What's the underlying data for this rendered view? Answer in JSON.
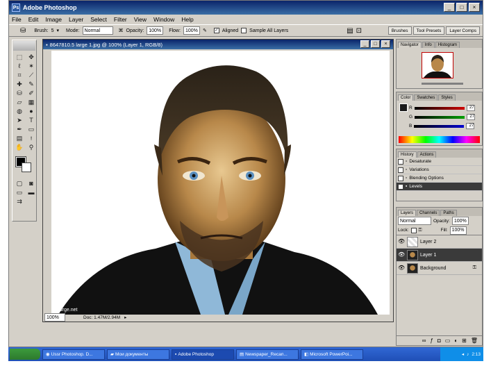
{
  "window": {
    "title": "Adobe Photoshop"
  },
  "menu": [
    "File",
    "Edit",
    "Image",
    "Layer",
    "Select",
    "Filter",
    "View",
    "Window",
    "Help"
  ],
  "options": {
    "brush_label": "Brush:",
    "brush_size": "5",
    "mode_label": "Mode:",
    "mode_value": "Normal",
    "opacity_label": "Opacity:",
    "opacity_value": "100%",
    "flow_label": "Flow:",
    "flow_value": "100%",
    "aligned_label": "Aligned",
    "sample_all_label": "Sample All Layers"
  },
  "palette_well": [
    "Brushes",
    "Tool Presets",
    "Layer Comps"
  ],
  "document": {
    "title": "8647810.5 large 1.jpg @ 100% (Layer 1, RGB/8)",
    "zoom": "100%",
    "doc_info": "Doc: 1.47M/2.94M",
    "watermark": "hourge.net"
  },
  "navigator": {
    "tabs": [
      "Navigator",
      "Info",
      "Histogram"
    ]
  },
  "color": {
    "tabs": [
      "Color",
      "Swatches",
      "Styles"
    ],
    "channels": [
      {
        "label": "R",
        "value": "27",
        "color": "#d00000"
      },
      {
        "label": "G",
        "value": "27",
        "color": "#00a000"
      },
      {
        "label": "B",
        "value": "27",
        "color": "#0000d0"
      }
    ]
  },
  "history": {
    "tabs": [
      "History",
      "Actions"
    ],
    "items": [
      "Desaturate",
      "Variations",
      "Blending Options",
      "Levels"
    ]
  },
  "layers": {
    "tabs": [
      "Layers",
      "Channels",
      "Paths"
    ],
    "blend_mode": "Normal",
    "opacity_label": "Opacity:",
    "opacity_value": "100%",
    "lock_label": "Lock:",
    "fill_label": "Fill:",
    "fill_value": "100%",
    "items": [
      {
        "name": "Layer 2"
      },
      {
        "name": "Layer 1"
      },
      {
        "name": "Background"
      }
    ]
  },
  "taskbar": {
    "items": [
      "Ussr Photoshop. D...",
      "Мои документы",
      "Adobe Photoshop",
      "Newspaper_Recaп...",
      "Microsoft PowerPoi..."
    ],
    "clock": "2:13"
  }
}
